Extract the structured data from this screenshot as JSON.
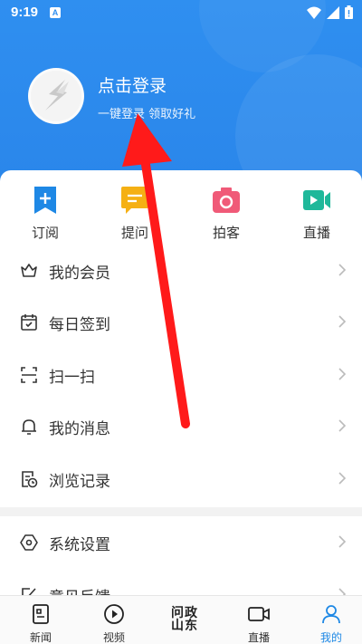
{
  "status_bar": {
    "time": "9:19",
    "notification_badge": "A"
  },
  "profile": {
    "login_title": "点击登录",
    "login_subtitle": "一键登录 领取好礼"
  },
  "quick_actions": [
    {
      "label": "订阅",
      "icon": "subscribe-icon",
      "color": "#1e88e5"
    },
    {
      "label": "提问",
      "icon": "question-icon",
      "color": "#f5b014"
    },
    {
      "label": "拍客",
      "icon": "camera-icon",
      "color": "#f05a78"
    },
    {
      "label": "直播",
      "icon": "live-icon",
      "color": "#1fb89a"
    }
  ],
  "menu": [
    {
      "label": "我的会员",
      "icon": "crown-icon"
    },
    {
      "label": "每日签到",
      "icon": "calendar-icon"
    },
    {
      "label": "扫一扫",
      "icon": "scan-icon"
    },
    {
      "label": "我的消息",
      "icon": "bell-icon"
    },
    {
      "label": "浏览记录",
      "icon": "history-icon"
    },
    {
      "label": "系统设置",
      "icon": "settings-icon"
    },
    {
      "label": "意见反馈",
      "icon": "feedback-icon"
    }
  ],
  "tabs": [
    {
      "label": "新闻",
      "icon": "news-icon"
    },
    {
      "label": "视频",
      "icon": "video-icon"
    },
    {
      "label": "问政山东",
      "icon": "brand-logo"
    },
    {
      "label": "直播",
      "icon": "live-tab-icon"
    },
    {
      "label": "我的",
      "icon": "profile-icon",
      "active": true
    }
  ],
  "colors": {
    "header_blue": "#2f8ff0",
    "annotation_arrow": "#ff1a1a",
    "active_tab": "#1e88e5"
  }
}
